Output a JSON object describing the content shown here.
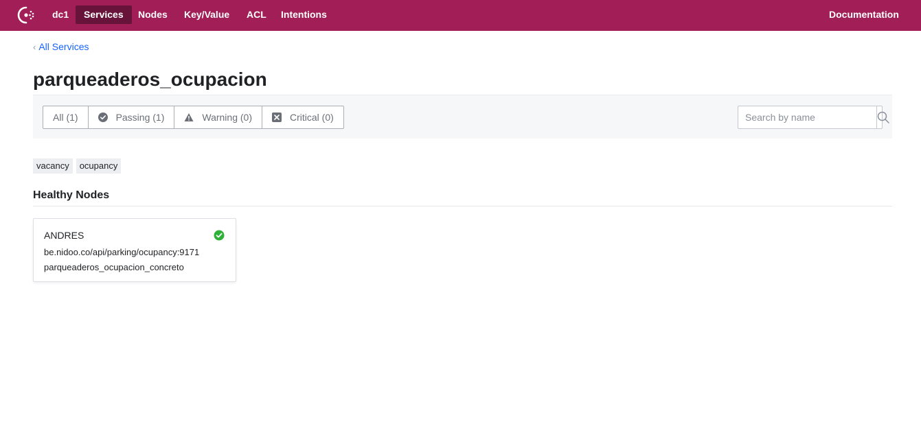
{
  "nav": {
    "datacenter": "dc1",
    "items": [
      {
        "label": "Services",
        "active": true
      },
      {
        "label": "Nodes",
        "active": false
      },
      {
        "label": "Key/Value",
        "active": false
      },
      {
        "label": "ACL",
        "active": false
      },
      {
        "label": "Intentions",
        "active": false
      }
    ],
    "documentation": "Documentation"
  },
  "breadcrumb": {
    "back_label": "All Services"
  },
  "page": {
    "title": "parqueaderos_ocupacion"
  },
  "filters": {
    "items": [
      {
        "label": "All (1)",
        "icon": "none"
      },
      {
        "label": "Passing (1)",
        "icon": "check-circle-icon"
      },
      {
        "label": "Warning (0)",
        "icon": "warning-triangle-icon"
      },
      {
        "label": "Critical (0)",
        "icon": "critical-x-icon"
      }
    ]
  },
  "search": {
    "placeholder": "Search by name",
    "value": ""
  },
  "tags": [
    "vacancy",
    "ocupancy"
  ],
  "healthy_nodes": {
    "heading": "Healthy Nodes",
    "nodes": [
      {
        "name": "ANDRES",
        "address": "be.nidoo.co/api/parking/ocupancy:9171",
        "service_id": "parqueaderos_ocupacion_concreto",
        "status": "passing"
      }
    ]
  },
  "colors": {
    "brand": "#a21e56",
    "nav_active": "#67133a",
    "link": "#1563ff",
    "passing": "#2eb039"
  }
}
